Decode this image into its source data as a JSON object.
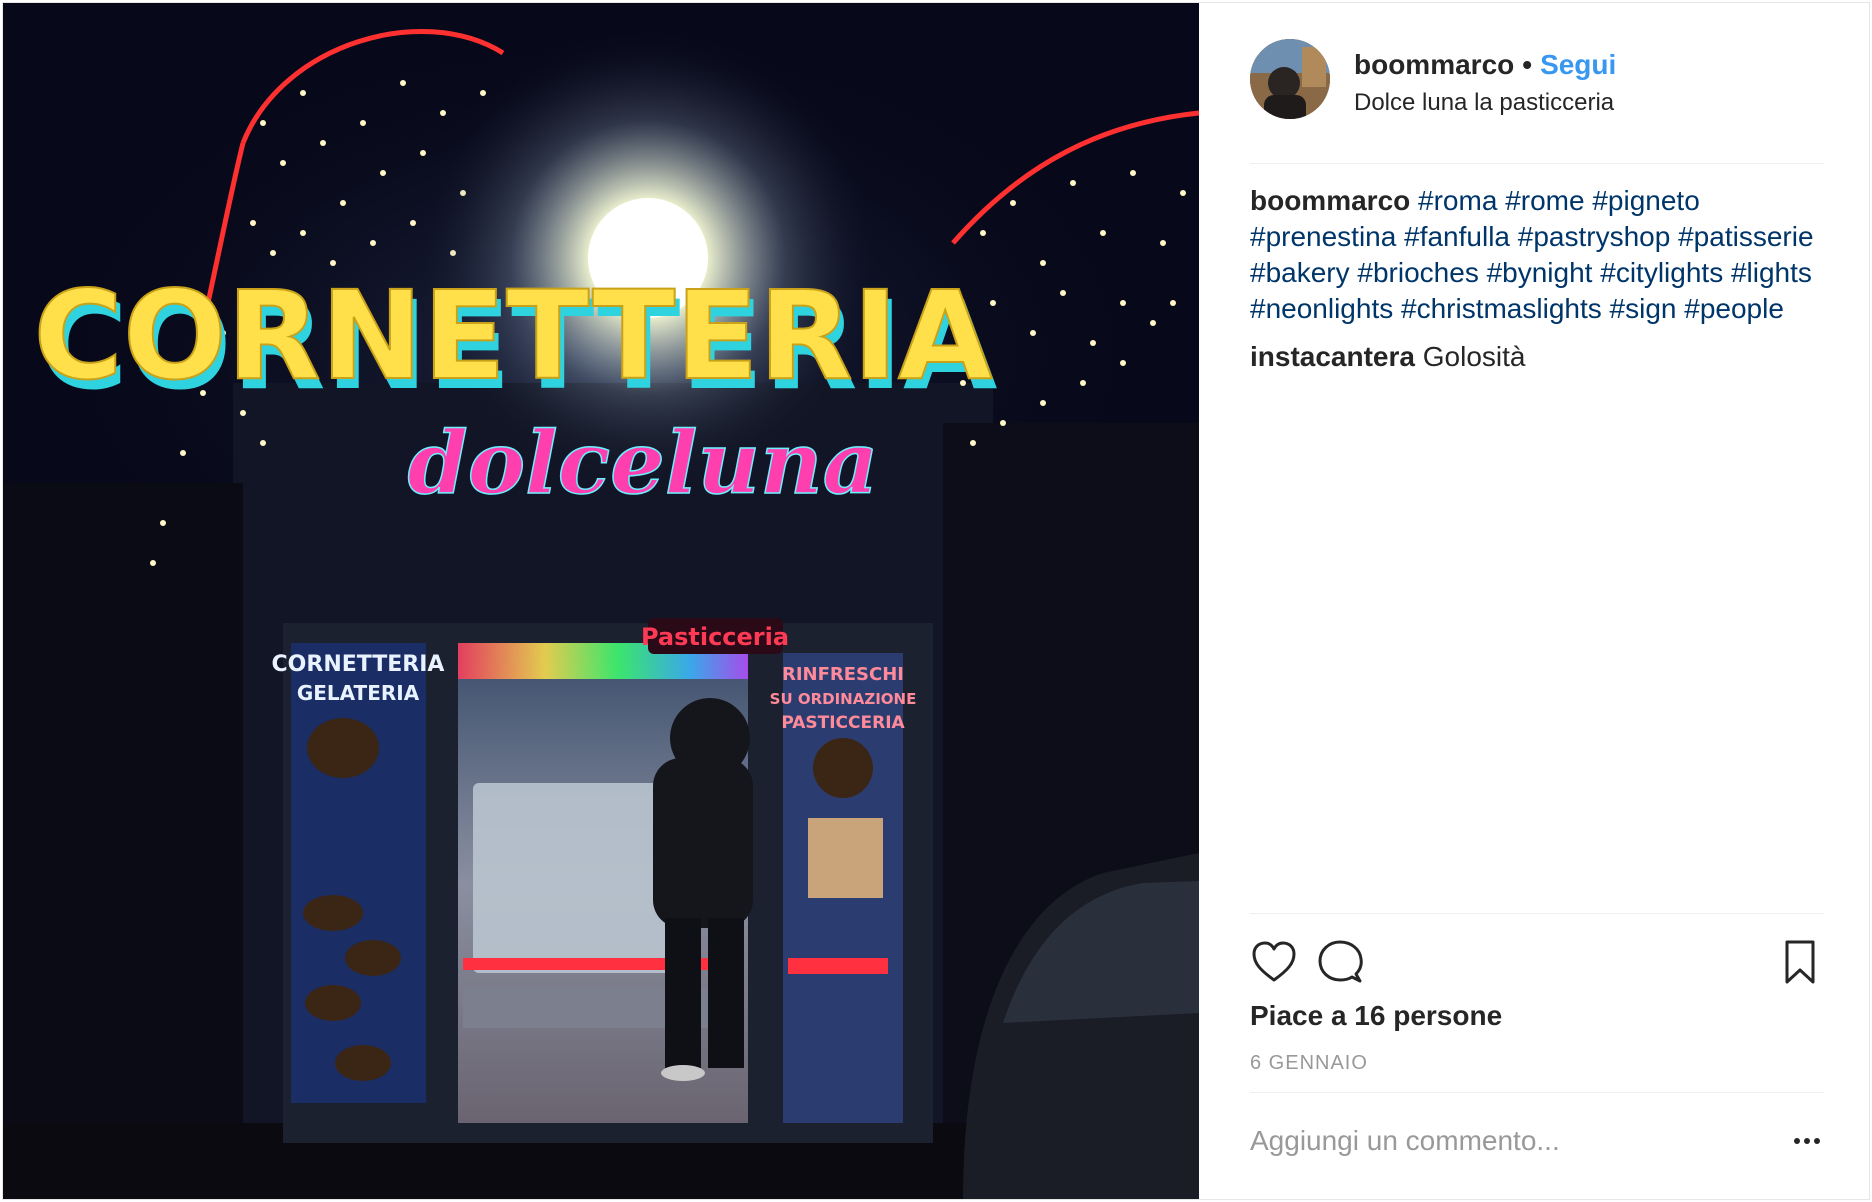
{
  "post": {
    "username": "boommarco",
    "separator": "•",
    "follow_label": "Segui",
    "location": "Dolce luna la pasticceria"
  },
  "photo": {
    "sign_main": "CORNETTERIA",
    "sign_sub": "dolceluna",
    "window_left_line1": "CORNETTERIA",
    "window_left_line2": "GELATERIA",
    "door_sign": "Pasticceria",
    "window_right_line1": "RINFRESCHI",
    "window_right_line2": "SU ORDINAZIONE",
    "window_right_line3": "PASTICCERIA"
  },
  "caption": {
    "username": "boommarco",
    "hashtags": [
      "#roma",
      "#rome",
      "#pigneto",
      "#prenestina",
      "#fanfulla",
      "#pastryshop",
      "#patisserie",
      "#bakery",
      "#brioches",
      "#bynight",
      "#citylights",
      "#lights",
      "#neonlights",
      "#christmaslights",
      "#sign",
      "#people"
    ]
  },
  "comments": [
    {
      "username": "instacantera",
      "text": "Golosità"
    }
  ],
  "likes_text": "Piace a 16 persone",
  "date": "6 GENNAIO",
  "comment_input": {
    "placeholder": "Aggiungi un commento..."
  },
  "icons": {
    "like": "heart-icon",
    "comment": "comment-bubble-icon",
    "save": "bookmark-icon",
    "more": "more-options-icon"
  },
  "colors": {
    "link": "#3897f0",
    "hashtag": "#003569",
    "muted": "#999999",
    "text": "#262626"
  }
}
